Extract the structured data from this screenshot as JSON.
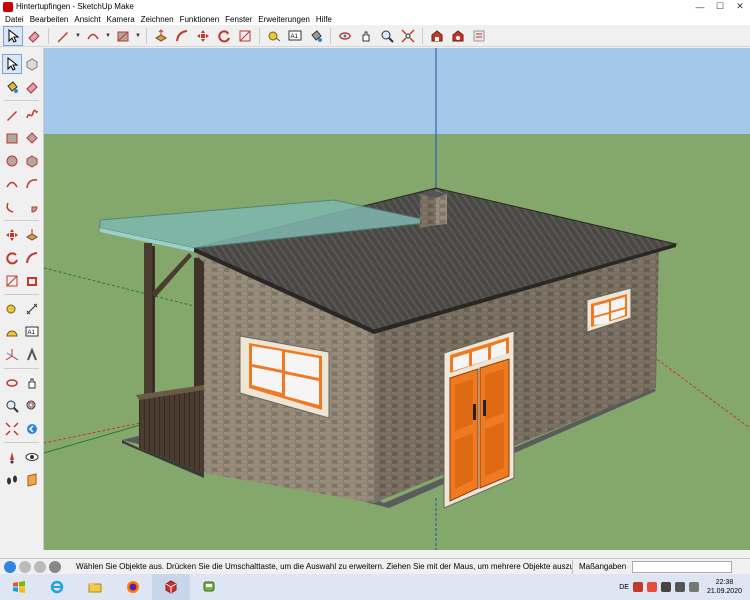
{
  "window": {
    "title": "Hintertupfingen - SketchUp Make",
    "minimize_glyph": "—",
    "maximize_glyph": "☐",
    "close_glyph": "✕"
  },
  "menu": [
    "Datei",
    "Bearbeiten",
    "Ansicht",
    "Kamera",
    "Zeichnen",
    "Funktionen",
    "Fenster",
    "Erweiterungen",
    "Hilfe"
  ],
  "toolbar": {
    "dropdown_glyph": "▼",
    "text_tool_label": "A1",
    "icons": [
      "select-icon",
      "eraser-icon",
      "pencil-icon",
      "arc-icon",
      "rectangle-icon",
      "push-pull-icon",
      "follow-me-icon",
      "move-icon",
      "rotate-icon",
      "scale-icon",
      "offset-icon",
      "tape-measure-icon",
      "text-icon",
      "paint-bucket-icon",
      "orbit-icon",
      "pan-icon",
      "zoom-icon",
      "zoom-extents-icon",
      "warehouse-icon",
      "extension-warehouse-icon",
      "layout-icon",
      "send-to-layout-icon"
    ]
  },
  "leftbar": {
    "text_tool_label": "A1",
    "icons": [
      "select-icon",
      "make-component-icon",
      "paint-bucket-icon",
      "eraser-icon",
      "line-icon",
      "freehand-icon",
      "rectangle-icon",
      "rotated-rectangle-icon",
      "circle-icon",
      "polygon-icon",
      "arc-icon",
      "two-point-arc-icon",
      "three-point-arc-icon",
      "pie-icon",
      "move-icon",
      "push-pull-icon",
      "rotate-icon",
      "follow-me-icon",
      "scale-icon",
      "offset-icon",
      "tape-measure-icon",
      "dimension-icon",
      "protractor-icon",
      "text-icon",
      "axes-icon",
      "3d-text-icon",
      "orbit-icon",
      "pan-icon",
      "zoom-icon",
      "zoom-window-icon",
      "zoom-extents-icon",
      "previous-view-icon",
      "position-camera-icon",
      "look-around-icon",
      "walk-icon",
      "section-plane-icon"
    ]
  },
  "status": {
    "message": "Wählen Sie Objekte aus. Drücken Sie die Umschalttaste, um die Auswahl zu erweitern. Ziehen Sie mit der Maus, um mehrere Objekte auszuwä...",
    "measurements_label": "Maßangaben",
    "measurements_value": ""
  },
  "taskbar": {
    "apps": [
      "start-icon",
      "ie-icon",
      "explorer-icon",
      "firefox-icon",
      "sketchup-icon",
      "train-app-icon"
    ],
    "time": "22:38",
    "date": "21.09.2020",
    "language": "DE"
  },
  "colors": {
    "sky": "#a3c8e8",
    "ground": "#84a86c",
    "roof": "#4a4844",
    "glass_roof": "#7fb8b0",
    "wall": "#8d8272",
    "door": "#f07a21",
    "frame": "#ede6d6",
    "wood": "#5d4b3b",
    "accent_red": "#c0392b"
  }
}
